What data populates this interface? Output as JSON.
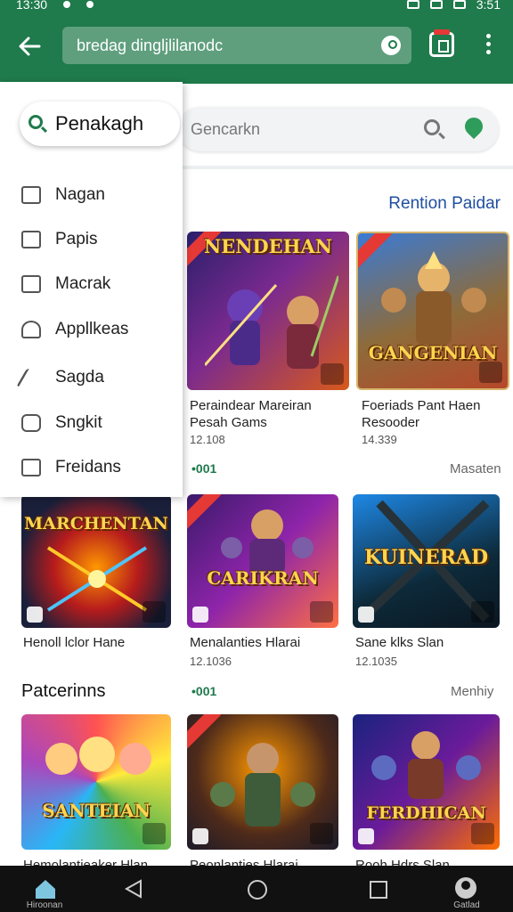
{
  "status_bar": {
    "time": "13:30",
    "right_time": "3:51"
  },
  "toolbar": {
    "url_text": "bredag dingljlilanodc"
  },
  "search": {
    "placeholder": "Gencarkn"
  },
  "section_link": "Rention Paidar",
  "drawer": {
    "search_label": "Penakagh",
    "items": [
      {
        "label": "Nagan",
        "icon": "list-icon"
      },
      {
        "label": "Papis",
        "icon": "library-icon"
      },
      {
        "label": "Macrak",
        "icon": "square-icon"
      },
      {
        "label": "Appllkeas",
        "icon": "person-icon"
      },
      {
        "label": "Sagda",
        "icon": "wand-icon"
      },
      {
        "label": "Sngkit",
        "icon": "game-icon"
      },
      {
        "label": "Freidans",
        "icon": "camera-icon"
      }
    ]
  },
  "row1": [
    {
      "art": "NENDEHAN",
      "title": "Peraindear Mareiran\nPesah Gams",
      "meta": "12.108"
    },
    {
      "art": "GANGENIAN",
      "title": "Foeriads Pant Haen\nResooder",
      "meta": "14.339"
    }
  ],
  "row2_dots": "•001",
  "row2_more": "Masaten",
  "row2": [
    {
      "art": "MARCHENTAN",
      "title": "Henoll lclor Hane",
      "meta": ""
    },
    {
      "art": "CARIKRAN",
      "title": "Menalanties Hlarai",
      "meta": "12.1036"
    },
    {
      "art": "KUINERAD",
      "title": "Sane klks Slan",
      "meta": "12.1035"
    }
  ],
  "section3": {
    "title": "Patcerinns",
    "dots": "•001",
    "more": "Menhiy"
  },
  "row3": [
    {
      "art": "SANTEIAN",
      "title": "Hemolantieaker Hlan"
    },
    {
      "art": "",
      "title": "Peonlanties Hlarai"
    },
    {
      "art": "FERDHICAN",
      "title": "Rooh Hdrs Slan"
    }
  ],
  "bottom_nav": [
    {
      "label": "Hiroonan",
      "icon": "home-icon"
    },
    {
      "label": "",
      "icon": "back-triangle-icon"
    },
    {
      "label": "",
      "icon": "home-circle-icon"
    },
    {
      "label": "",
      "icon": "recents-square-icon"
    },
    {
      "label": "Gatlad",
      "icon": "account-icon"
    }
  ],
  "colors": {
    "brand": "#1f7a4c",
    "link": "#1f4fa0",
    "nav": "#111111"
  }
}
